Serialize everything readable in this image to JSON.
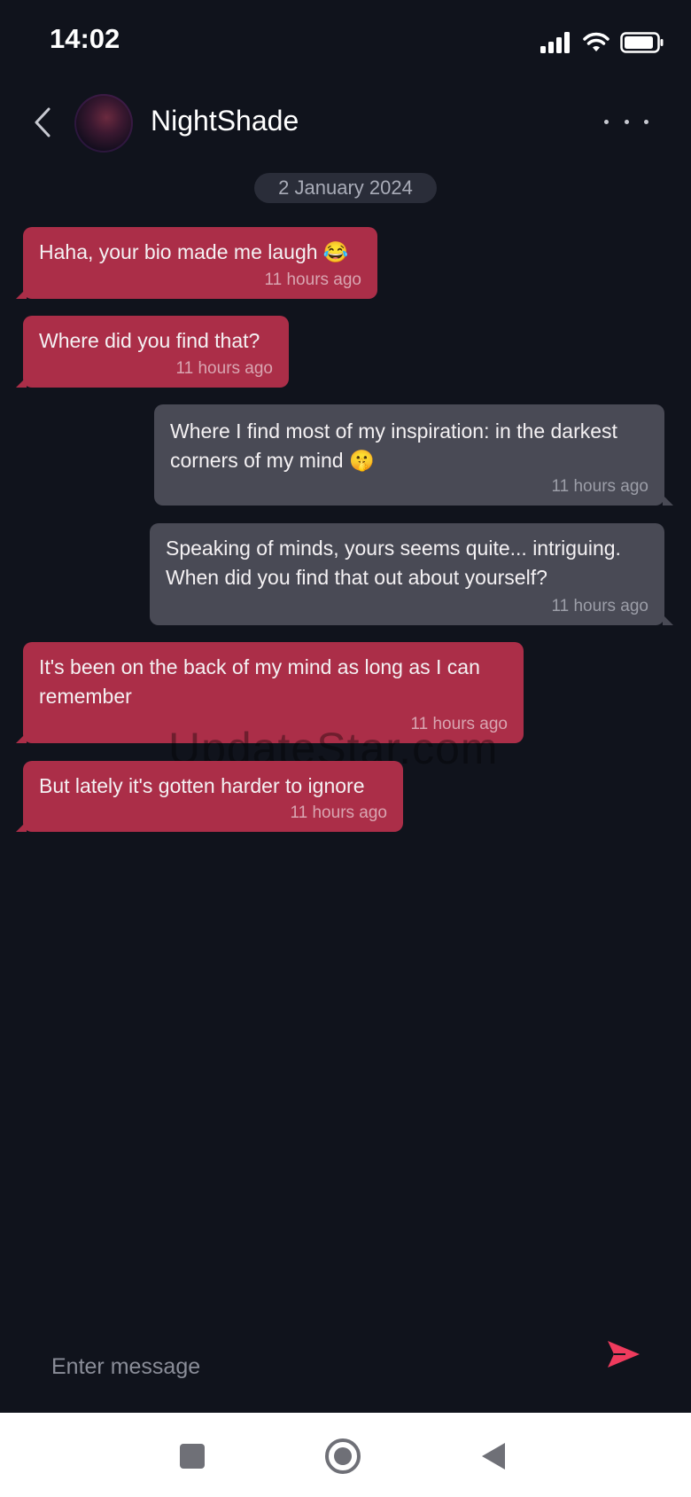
{
  "status_bar": {
    "time": "14:02"
  },
  "header": {
    "contact_name": "NightShade"
  },
  "conversation": {
    "date_label": "2 January 2024",
    "messages": [
      {
        "direction": "incoming",
        "text": "Haha, your bio made me laugh 😂",
        "time": "11 hours ago"
      },
      {
        "direction": "incoming",
        "text": "Where did you find that?",
        "time": "11 hours ago"
      },
      {
        "direction": "outgoing",
        "text": "Where I find most of my inspiration: in the darkest corners of my mind 🤫",
        "time": "11 hours ago"
      },
      {
        "direction": "outgoing",
        "text": "Speaking of minds, yours seems quite... intriguing. When did you find that out about yourself?",
        "time": "11 hours ago"
      },
      {
        "direction": "incoming",
        "text": "It's been on the back of my mind as long as I can remember",
        "time": "11 hours ago"
      },
      {
        "direction": "incoming",
        "text": "But lately it's gotten harder to ignore",
        "time": "11 hours ago"
      }
    ]
  },
  "watermark": "UpdateStar.com",
  "composer": {
    "placeholder": "Enter message"
  },
  "colors": {
    "background": "#10131c",
    "incoming_bubble": "#ab2e48",
    "outgoing_bubble": "#494a55",
    "accent_send": "#ef3b5d"
  },
  "icons": {
    "back": "chevron-left-icon",
    "more": "more-horizontal-icon",
    "send": "send-icon",
    "nav_recents": "square-icon",
    "nav_home": "circle-icon",
    "nav_back": "triangle-back-icon"
  }
}
